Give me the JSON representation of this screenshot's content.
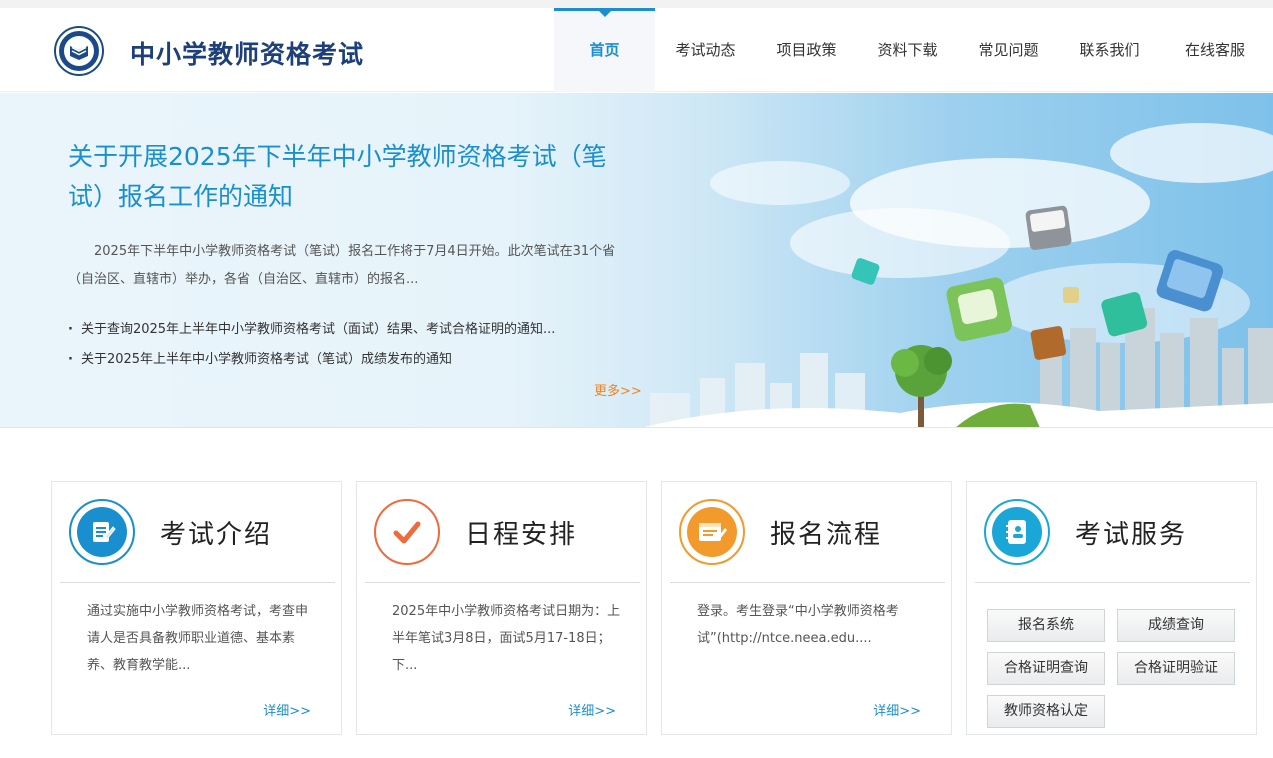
{
  "header": {
    "site_title": "中小学教师资格考试",
    "logo_icon": "book-emblem-icon",
    "nav": [
      {
        "label": "首页",
        "active": true
      },
      {
        "label": "考试动态",
        "active": false
      },
      {
        "label": "项目政策",
        "active": false
      },
      {
        "label": "资料下载",
        "active": false
      },
      {
        "label": "常见问题",
        "active": false
      },
      {
        "label": "联系我们",
        "active": false
      },
      {
        "label": "在线客服",
        "active": false
      }
    ]
  },
  "banner": {
    "headline": "关于开展2025年下半年中小学教师资格考试（笔试）报名工作的通知",
    "summary": "2025年下半年中小学教师资格考试（笔试）报名工作将于7月4日开始。此次笔试在31个省（自治区、直辖市）举办，各省（自治区、直辖市）的报名...",
    "news": [
      "关于查询2025年上半年中小学教师资格考试（面试）结果、考试合格证明的通知...",
      "关于2025年上半年中小学教师资格考试（笔试）成绩发布的通知"
    ],
    "more": "更多>>"
  },
  "cards": [
    {
      "title": "考试介绍",
      "icon": "edit-document-icon",
      "text": "通过实施中小学教师资格考试，考查申请人是否具备教师职业道德、基本素养、教育教学能...",
      "detail": "详细>>",
      "color": "#1a8fd0"
    },
    {
      "title": "日程安排",
      "icon": "checkmark-icon",
      "text": "2025年中小学教师资格考试日期为：上半年笔试3月8日，面试5月17-18日；下...",
      "detail": "详细>>",
      "color": "#ef6a3c"
    },
    {
      "title": "报名流程",
      "icon": "registration-form-icon",
      "text": "登录。考生登录“中小学教师资格考试”(http://ntce.neea.edu....",
      "detail": "详细>>",
      "color": "#f39a2d"
    },
    {
      "title": "考试服务",
      "icon": "service-book-icon",
      "color": "#1aa7d8",
      "buttons": [
        "报名系统",
        "成绩查询",
        "合格证明查询",
        "合格证明验证",
        "教师资格认定"
      ]
    }
  ]
}
